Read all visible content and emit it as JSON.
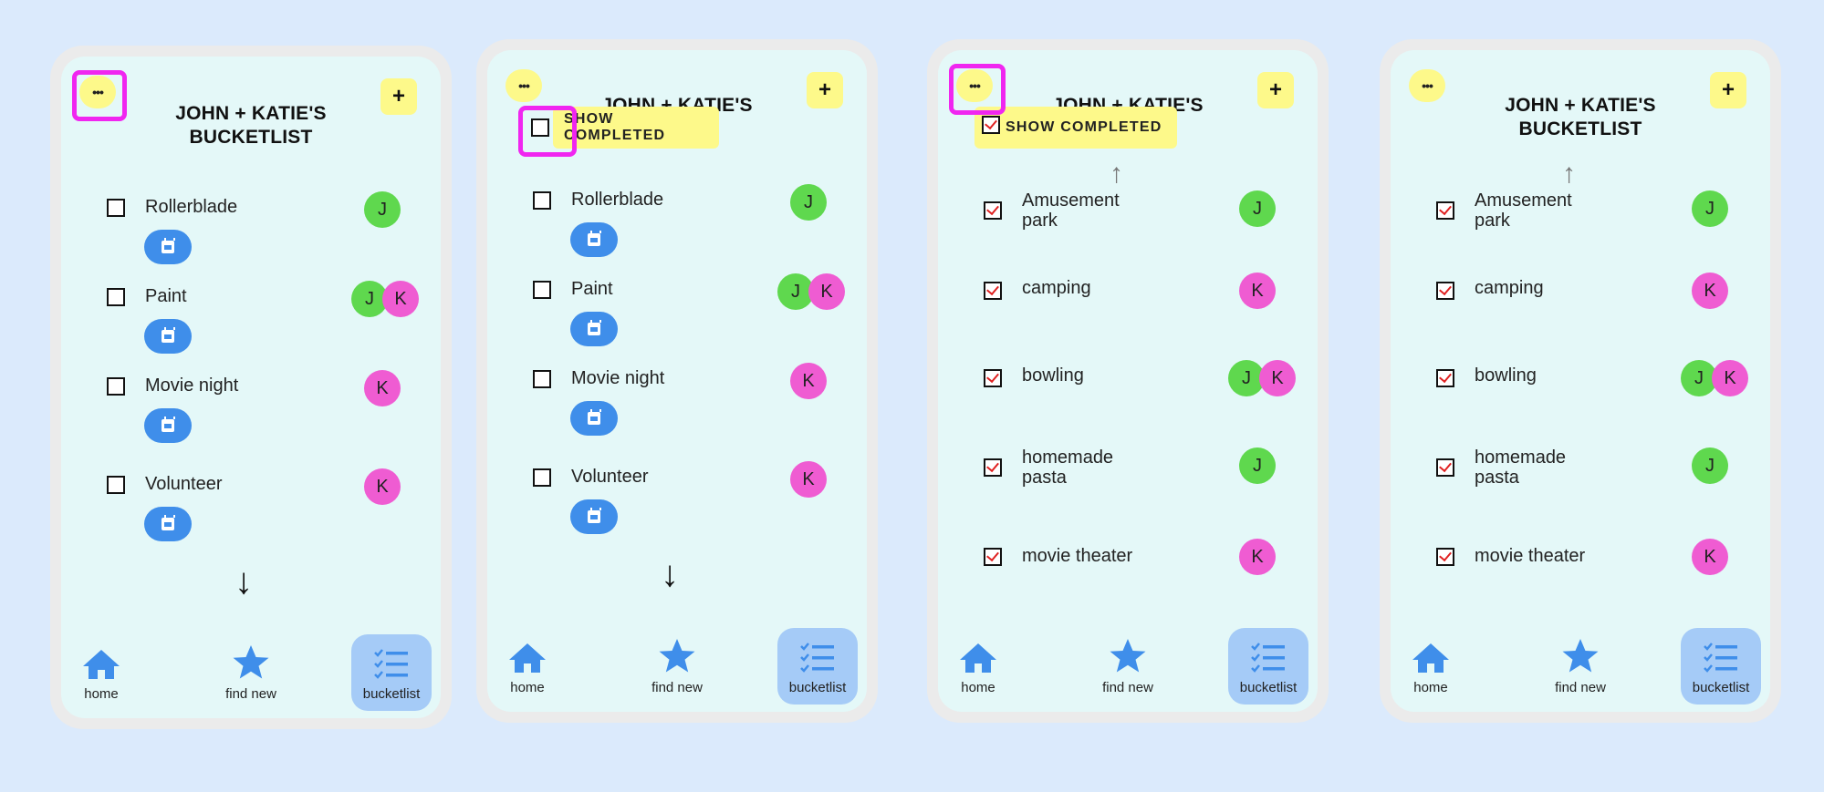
{
  "app": {
    "title_line1": "JOHN + KATIE'S",
    "title_line2": "BUCKETLIST",
    "menu_glyph": "•••",
    "add_glyph": "+",
    "show_completed_label": "SHOW COMPLETED",
    "colors": {
      "background": "#dbeafc",
      "screen": "#e4f8f8",
      "yellow": "#fdf98a",
      "highlight": "#f026f0",
      "blue": "#3f8eea",
      "avatar_j": "#5fd84e",
      "avatar_k": "#ef5cd2",
      "nav_active": "#a5cbf7"
    }
  },
  "nav": [
    {
      "label": "home",
      "icon": "home-icon"
    },
    {
      "label": "find new",
      "icon": "star-icon"
    },
    {
      "label": "bucketlist",
      "icon": "checklist-icon"
    }
  ],
  "active_items": [
    {
      "label": "Rollerblade",
      "people": [
        "J"
      ]
    },
    {
      "label": "Paint",
      "people": [
        "J",
        "K"
      ]
    },
    {
      "label": "Movie night",
      "people": [
        "K"
      ]
    },
    {
      "label": "Volunteer",
      "people": [
        "K"
      ]
    }
  ],
  "completed_items": [
    {
      "label": "Amusement park",
      "line1": "Amusement",
      "line2": "park",
      "people": [
        "J"
      ]
    },
    {
      "label": "camping",
      "people": [
        "K"
      ]
    },
    {
      "label": "bowling",
      "people": [
        "J",
        "K"
      ]
    },
    {
      "label": "homemade pasta",
      "line1": "homemade",
      "line2": "pasta",
      "people": [
        "J"
      ]
    },
    {
      "label": "movie theater",
      "people": [
        "K"
      ]
    }
  ]
}
